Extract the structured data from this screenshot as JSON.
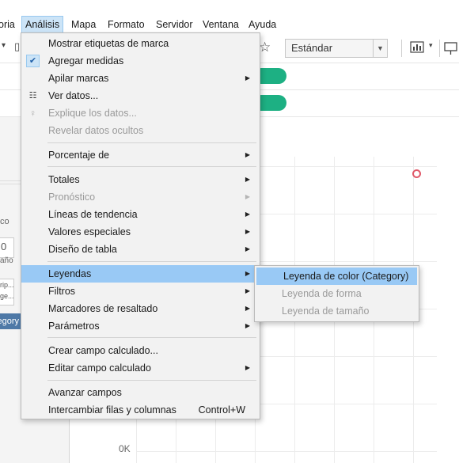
{
  "menubar": {
    "items": [
      "oria",
      "Análisis",
      "Mapa",
      "Formato",
      "Servidor",
      "Ventana",
      "Ayuda"
    ]
  },
  "toolbar": {
    "fit_combo": {
      "value": "Estándar"
    },
    "icons": [
      "chevron-down-icon",
      "star-icon",
      "show-me-icon",
      "presentation-icon"
    ]
  },
  "left_pane": {
    "field_hint": "co",
    "size_value": "0",
    "size_label": "año",
    "tooltip_label_1": "rip...",
    "tooltip_label_2": "ge...",
    "color_pill": "Category"
  },
  "chart": {
    "y_axis_label": "0K",
    "mark_color": "#e05a6a",
    "pill_color": "#1db083"
  },
  "analysis_menu": {
    "items": [
      {
        "label": "Mostrar etiquetas de marca"
      },
      {
        "label": "Agregar medidas",
        "checked": true
      },
      {
        "label": "Apilar marcas",
        "submenu": true
      },
      {
        "label": "Ver datos...",
        "icon": "view-data-icon"
      },
      {
        "label": "Explique los datos...",
        "disabled": true,
        "icon": "lightbulb-icon"
      },
      {
        "label": "Revelar datos ocultos",
        "disabled": true
      },
      {
        "label": "Porcentaje de",
        "submenu": true
      },
      {
        "label": "Totales",
        "submenu": true
      },
      {
        "label": "Pronóstico",
        "submenu": true,
        "disabled": true
      },
      {
        "label": "Líneas de tendencia",
        "submenu": true
      },
      {
        "label": "Valores especiales",
        "submenu": true
      },
      {
        "label": "Diseño de tabla",
        "submenu": true
      },
      {
        "label": "Leyendas",
        "submenu": true,
        "highlighted": true
      },
      {
        "label": "Filtros",
        "submenu": true
      },
      {
        "label": "Marcadores de resaltado",
        "submenu": true
      },
      {
        "label": "Parámetros",
        "submenu": true
      },
      {
        "label": "Crear campo calculado..."
      },
      {
        "label": "Editar campo calculado",
        "submenu": true
      },
      {
        "label": "Avanzar campos"
      },
      {
        "label": "Intercambiar filas y columnas",
        "shortcut": "Control+W"
      }
    ]
  },
  "legends_submenu": {
    "items": [
      {
        "label": "Leyenda de color (Category)",
        "highlighted": true
      },
      {
        "label": "Leyenda de forma",
        "disabled": true
      },
      {
        "label": "Leyenda de tamaño",
        "disabled": true
      }
    ]
  },
  "colors": {
    "menu_highlight": "#99c9f5",
    "menubar_active": "#cce4f7",
    "category_pill": "#4e79a7"
  }
}
